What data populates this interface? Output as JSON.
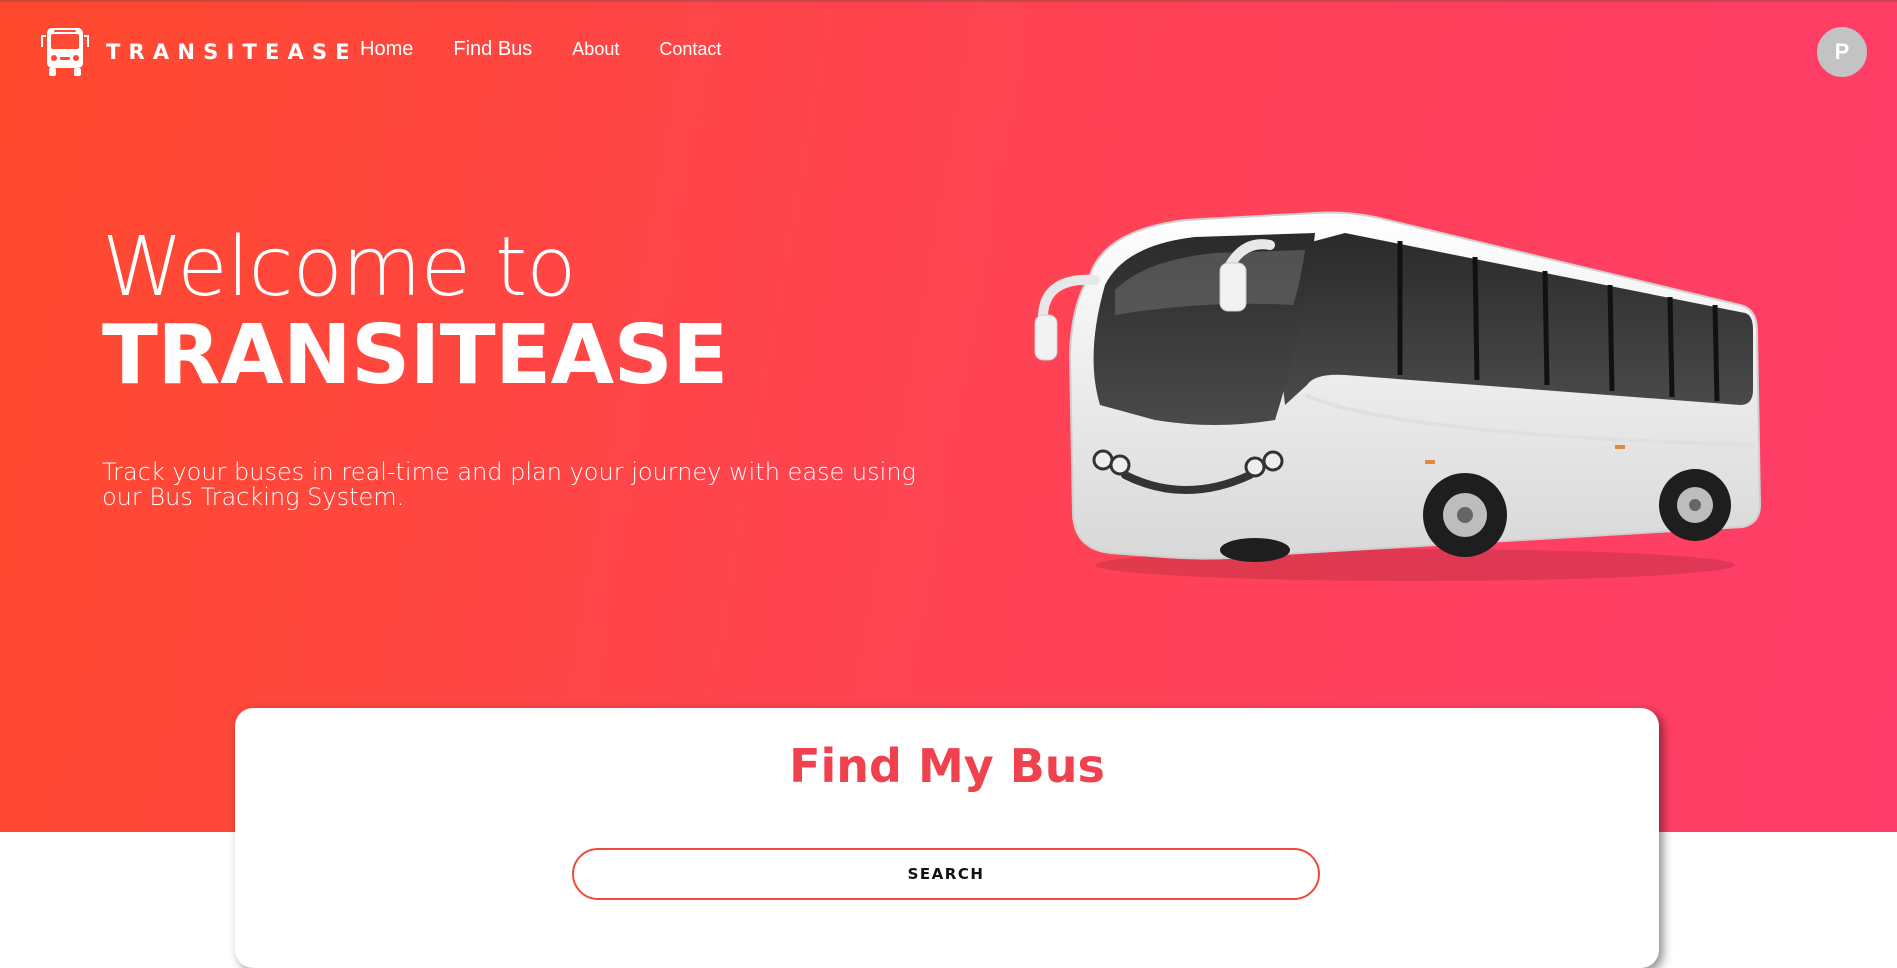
{
  "navbar": {
    "brand_name": "TRANSITEASE",
    "logo_icon": "bus-icon",
    "links": [
      {
        "label": "Home"
      },
      {
        "label": "Find Bus"
      },
      {
        "label": "About"
      },
      {
        "label": "Contact"
      }
    ],
    "avatar_initial": "P"
  },
  "hero": {
    "welcome": "Welcome to",
    "title": "TRANSITEASE",
    "tagline": "Track your buses in real-time and plan your journey with ease using our Bus Tracking System.",
    "image_icon": "bus-illustration"
  },
  "search_card": {
    "title": "Find My Bus",
    "button_label": "SEARCH"
  },
  "colors": {
    "gradient_start": "#ff4a2d",
    "gradient_end": "#ff3d6a",
    "accent": "#f0414f",
    "avatar": "#c3c3c3"
  }
}
